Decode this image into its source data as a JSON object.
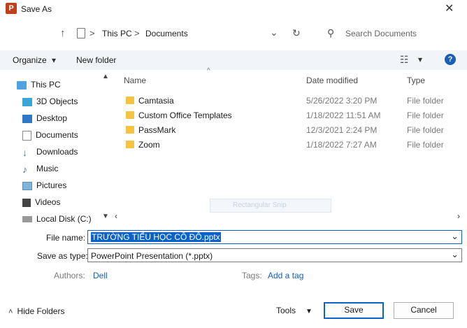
{
  "window": {
    "title": "Save As",
    "close_glyph": "✕",
    "app_icon": "P"
  },
  "address": {
    "back_glyph": "↑",
    "crumbs": [
      "This PC",
      "Documents"
    ],
    "separator": ">",
    "dropdown_glyph": "⌄",
    "refresh_glyph": "↻",
    "search_placeholder": "Search Documents",
    "search_glyph": "⚲"
  },
  "toolbar": {
    "organize_label": "Organize",
    "organize_caret": "▾",
    "new_folder_label": "New folder",
    "view_glyph": "☷",
    "view_caret": "▾",
    "help_glyph": "?"
  },
  "sidebar": {
    "items": [
      {
        "label": "This PC",
        "icon": "computer-icon"
      },
      {
        "label": "3D Objects",
        "icon": "cube-icon"
      },
      {
        "label": "Desktop",
        "icon": "desktop-icon"
      },
      {
        "label": "Documents",
        "icon": "document-icon"
      },
      {
        "label": "Downloads",
        "icon": "download-icon"
      },
      {
        "label": "Music",
        "icon": "music-icon"
      },
      {
        "label": "Pictures",
        "icon": "picture-icon"
      },
      {
        "label": "Videos",
        "icon": "video-icon"
      },
      {
        "label": "Local Disk (C:)",
        "icon": "drive-icon"
      }
    ]
  },
  "filelist": {
    "columns": {
      "name": "Name",
      "date": "Date modified",
      "type": "Type"
    },
    "rows": [
      {
        "name": "Camtasia",
        "date": "5/26/2022 3:20 PM",
        "type": "File folder"
      },
      {
        "name": "Custom Office Templates",
        "date": "1/18/2022 11:51 AM",
        "type": "File folder"
      },
      {
        "name": "PassMark",
        "date": "12/3/2021 2:24 PM",
        "type": "File folder"
      },
      {
        "name": "Zoom",
        "date": "1/18/2022 7:27 AM",
        "type": "File folder"
      }
    ],
    "ghost_overlay": "Rectangular Snip"
  },
  "form": {
    "filename_label": "File name:",
    "filename_value": "TRƯỜNG TIỂU HỌC CÔ ĐÔ.pptx",
    "saveas_label": "Save as type:",
    "saveas_value": "PowerPoint Presentation (*.pptx)",
    "authors_label": "Authors:",
    "authors_value": "Dell",
    "tags_label": "Tags:",
    "tags_value": "Add a tag"
  },
  "footer": {
    "hide_folders": "Hide Folders",
    "tools": "Tools",
    "save": "Save",
    "cancel": "Cancel"
  }
}
